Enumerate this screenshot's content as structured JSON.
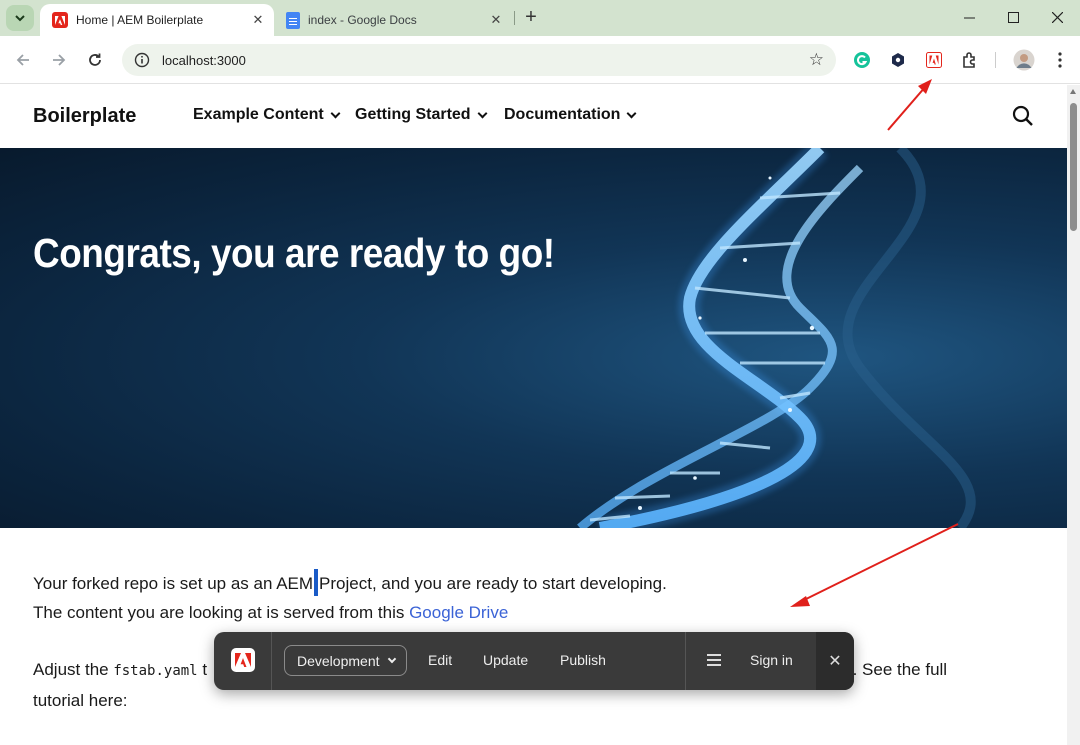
{
  "browser": {
    "tabs": [
      {
        "title": "Home | AEM Boilerplate",
        "close": "✕"
      },
      {
        "title": "index - Google Docs",
        "close": "✕"
      }
    ],
    "new_tab": "+",
    "url": "localhost:3000",
    "icons": [
      "tab-search-icon",
      "back-icon",
      "forward-icon",
      "reload-icon",
      "site-info-icon",
      "bookmark-star-icon",
      "grammarly-icon",
      "extension-hex-icon",
      "adobe-sidekick-icon",
      "extensions-puzzle-icon",
      "profile-avatar-icon",
      "more-vert-icon"
    ]
  },
  "site": {
    "brand": "Boilerplate",
    "nav": [
      "Example Content",
      "Getting Started",
      "Documentation"
    ],
    "hero_title": "Congrats, you are ready to go!",
    "para1_a": "Your forked repo is set up as an AEM",
    "para1_b": "Project, and you are ready to start developing.",
    "para2_a": "The content you are looking at is served from this ",
    "para2_link": "Google Drive",
    "para3_a": "Adjust the ",
    "para3_code": "fstab.yaml",
    "para3_b": " t",
    "para3_c": "EM. See the full",
    "para4": "tutorial here:"
  },
  "sidekick": {
    "environment": "Development",
    "buttons": [
      "Edit",
      "Update",
      "Publish"
    ],
    "sign_in": "Sign in",
    "close": "✕"
  },
  "colors": {
    "accent_link": "#3b63d6",
    "annotation_arrow": "#e0201b",
    "adobe_red": "#e4261c"
  }
}
